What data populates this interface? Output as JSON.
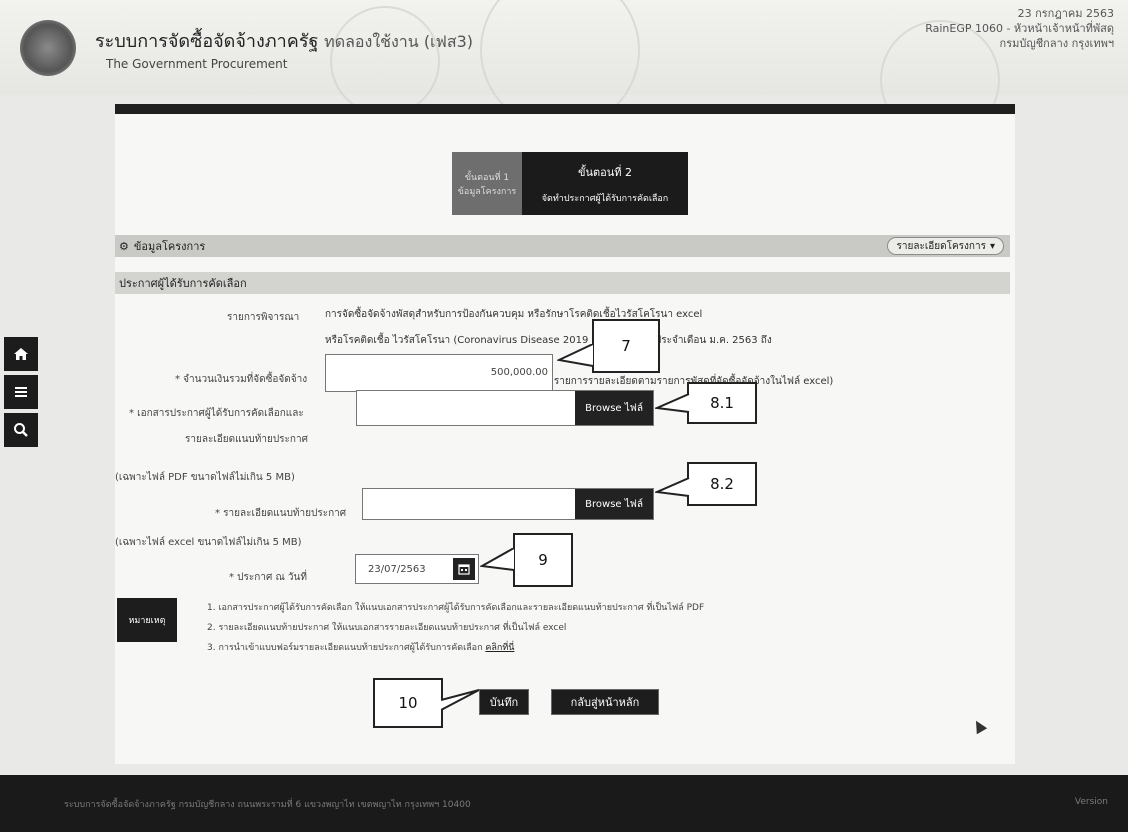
{
  "header": {
    "title": "ระบบการจัดซื้อจัดจ้างภาครัฐ",
    "title_suffix": "ทดลองใช้งาน (เฟส3)",
    "subtitle": "The Government Procurement",
    "date": "23 กรกฎาคม 2563",
    "user_line": "RainEGP 1060 - หัวหน้าเจ้าหน้าที่พัสดุ",
    "org_line": "กรมบัญชีกลาง กรุงเทพฯ"
  },
  "sidebar": {
    "tools": [
      {
        "icon": "home-icon"
      },
      {
        "icon": "menu-icon"
      },
      {
        "icon": "search-icon"
      }
    ]
  },
  "steps": {
    "step1": {
      "number": "ขั้นตอนที่ 1",
      "label": "ข้อมูลโครงการ"
    },
    "step2": {
      "number": "ขั้นตอนที่ 2",
      "label": "จัดทำประกาศผู้ได้รับการคัดเลือก"
    }
  },
  "sections": {
    "project_info": "ข้อมูลโครงการ",
    "project_detail_button": "รายละเอียดโครงการ",
    "announcement": "ประกาศผู้ได้รับการคัดเลือก"
  },
  "form": {
    "item_label": "รายการพิจารณา",
    "item_value_line1": "การจัดซื้อจัดจ้างพัสดุสำหรับการป้องกันควบคุม หรือรักษาโรคติดเชื้อไวรัสโคโรนา excel",
    "item_value_line2": "หรือโรคติดเชื้อ ไวรัสโคโรนา (Coronavirus Disease 2019 (COVID-19)) ประจำเดือน ม.ค. 2563 ถึง",
    "item_value_line3": "(รายการรายละเอียดตามรายการพัสดุที่จัดซื้อจัดจ้างในไฟล์ excel)",
    "amount_label": "* จำนวนเงินรวมที่จัดซื้อจัดจ้าง",
    "amount_value": "500,000.00",
    "doc1_label_line1": "* เอกสารประกาศผู้ได้รับการคัดเลือกและ",
    "doc1_label_line2": "รายละเอียดแนบท้ายประกาศ",
    "doc1_hint": "(เฉพาะไฟล์ PDF ขนาดไฟล์ไม่เกิน 5 MB)",
    "doc2_label": "* รายละเอียดแนบท้ายประกาศ",
    "doc2_hint": "(เฉพาะไฟล์ excel ขนาดไฟล์ไม่เกิน 5 MB)",
    "date_label": "* ประกาศ ณ วันที่",
    "date_value": "23/07/2563",
    "browse_label": "Browse ไฟล์"
  },
  "callouts": {
    "c7": "7",
    "c81": "8.1",
    "c82": "8.2",
    "c9": "9",
    "c10": "10"
  },
  "notes": {
    "badge": "หมายเหตุ",
    "line1": "1. เอกสารประกาศผู้ได้รับการคัดเลือก ให้แนบเอกสารประกาศผู้ได้รับการคัดเลือกและรายละเอียดแนบท้ายประกาศ ที่เป็นไฟล์ PDF",
    "line2": "2. รายละเอียดแนบท้ายประกาศ ให้แนบเอกสารรายละเอียดแนบท้ายประกาศ ที่เป็นไฟล์ excel",
    "line3": "3. การนำเข้าแบบฟอร์มรายละเอียดแนบท้ายประกาศผู้ได้รับการคัดเลือก",
    "line3_link": "คลิกที่นี่"
  },
  "buttons": {
    "save": "บันทึก",
    "back": "กลับสู่หน้าหลัก"
  },
  "footer": {
    "text": "ระบบการจัดซื้อจัดจ้างภาครัฐ กรมบัญชีกลาง ถนนพระรามที่ 6 แขวงพญาไท เขตพญาไท กรุงเทพฯ 10400",
    "right": "Version"
  }
}
